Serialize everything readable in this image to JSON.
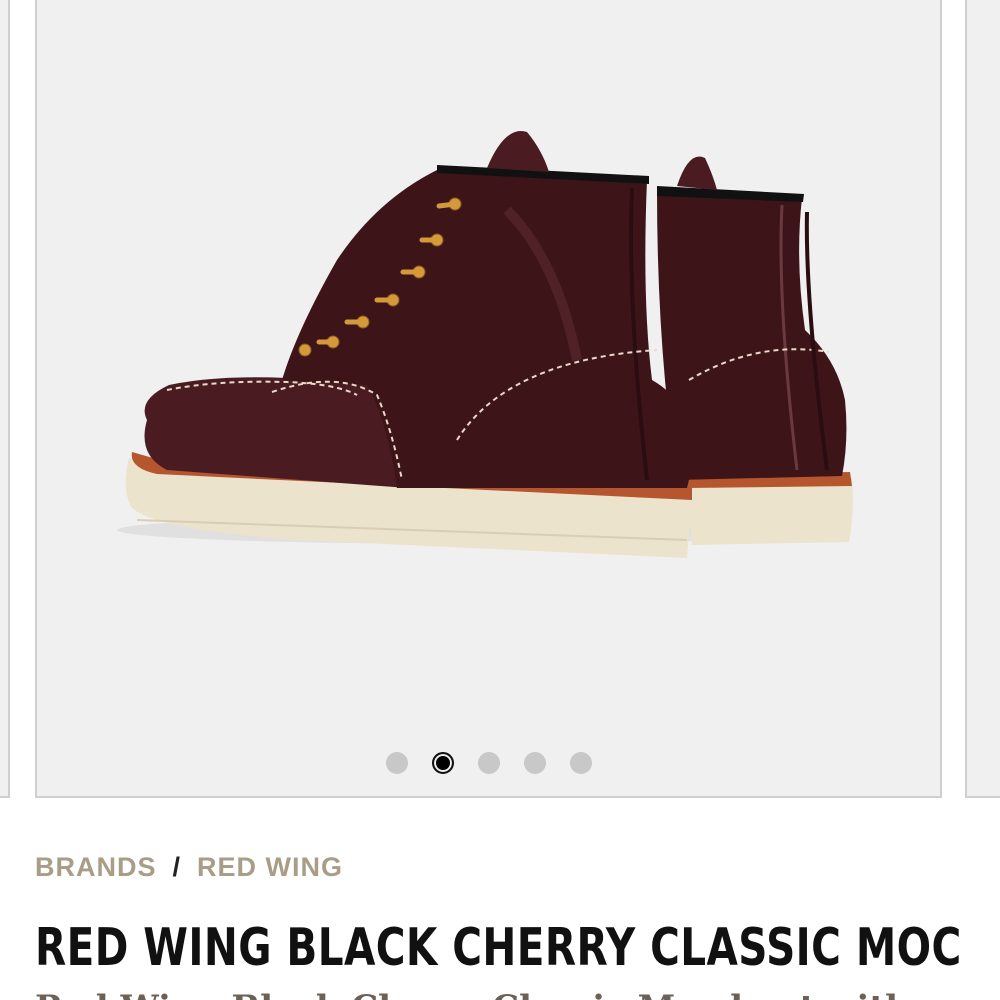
{
  "carousel": {
    "image_alt": "Red Wing Black Cherry Classic Moc boots",
    "dot_count": 5,
    "active_index": 1
  },
  "breadcrumb": {
    "brands_label": "BRANDS",
    "separator": "/",
    "brand_label": "RED WING"
  },
  "product": {
    "title": "RED WING BLACK CHERRY CLASSIC MOC",
    "subtitle_partial": "Red Wing Black Cherry Classic Moc boot with"
  },
  "colors": {
    "breadcrumb": "#a99d88",
    "title": "#111111",
    "leather": "#4a1c22",
    "sole": "#ece3cd",
    "laces": "#d49a3a"
  }
}
